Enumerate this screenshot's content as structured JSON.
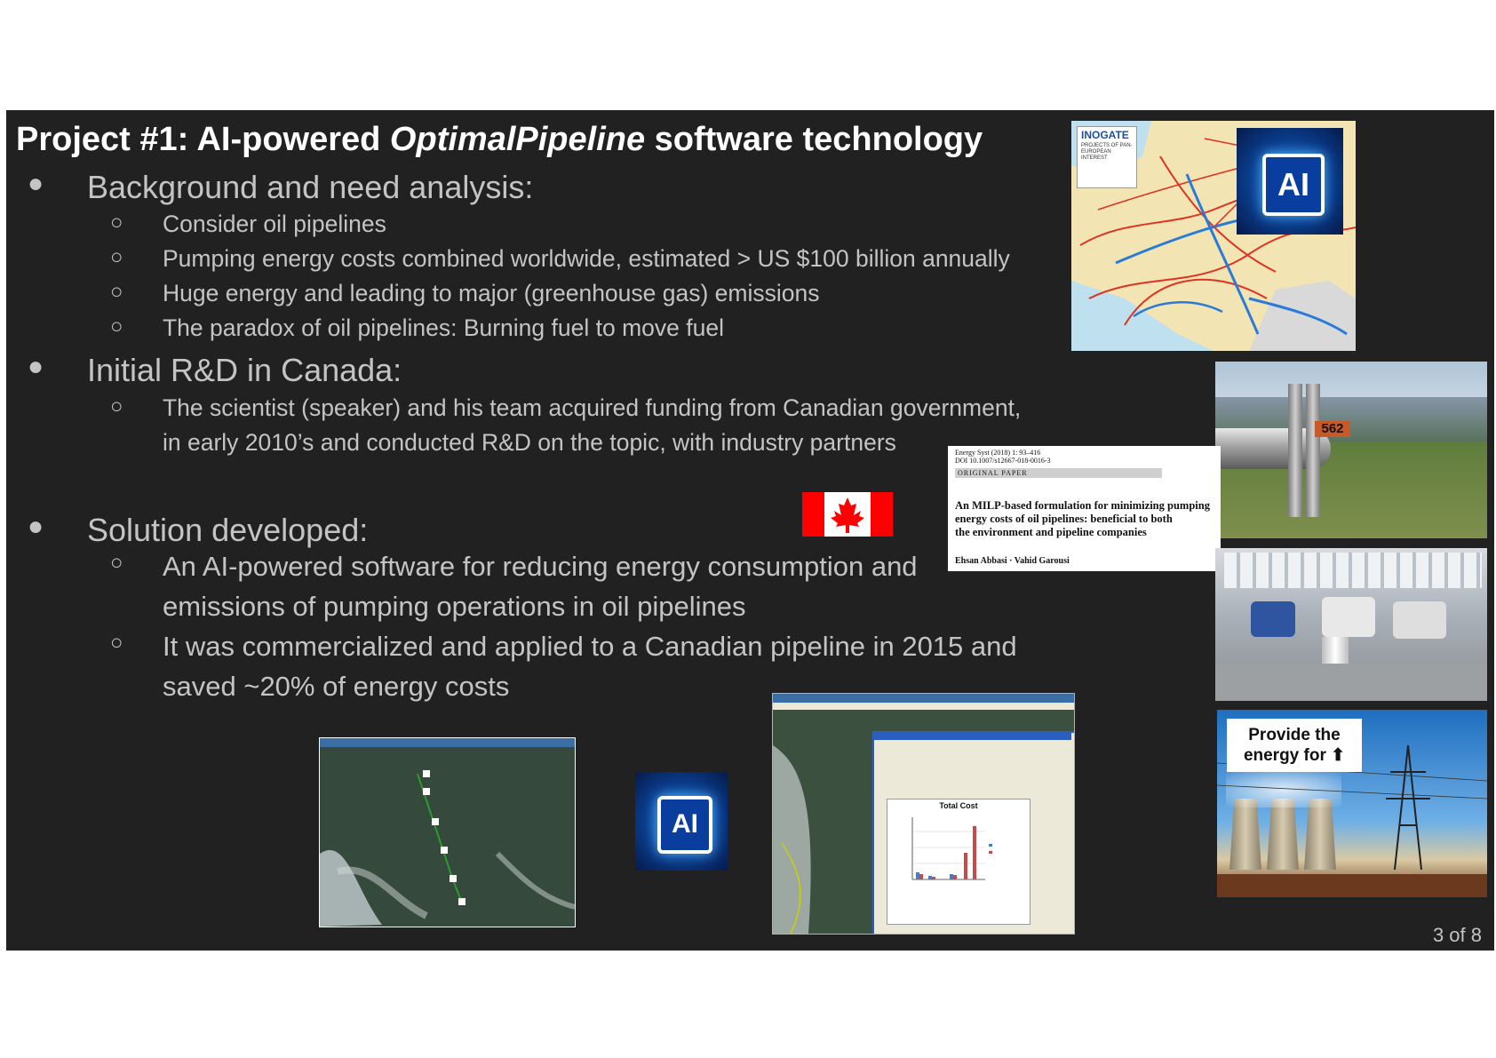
{
  "title": {
    "prefix": "Project #1: AI-powered ",
    "italic": "OptimalPipeline",
    "suffix": " software technology"
  },
  "sections": [
    {
      "heading": "Background and need analysis:",
      "items": [
        "Consider oil pipelines",
        "Pumping energy costs combined worldwide, estimated > US $100 billion annually",
        "Huge energy and leading to major (greenhouse gas) emissions",
        "The paradox of oil pipelines: Burning fuel to move fuel"
      ]
    },
    {
      "heading": "Initial R&D in Canada:",
      "items": [
        "The scientist (speaker) and his team acquired funding from Canadian government,",
        "in early 2010’s and conducted R&D on the topic, with industry partners"
      ]
    },
    {
      "heading": "Solution developed:",
      "items": [
        "An AI-powered software for reducing energy consumption and",
        "emissions of pumping operations in oil pipelines",
        "It was commercialized and applied to a Canadian pipeline in 2015 and",
        "saved ~20% of energy costs"
      ]
    }
  ],
  "bullet_symbol": "●",
  "sub_bullet_symbol": "○",
  "ai_badge": "AI",
  "map": {
    "logo": "INOGATE",
    "caption": "PROJECTS OF PAN-EUROPEAN INTEREST"
  },
  "pipeline_sign": "562",
  "paper": {
    "header1": "Energy Syst (2018) 1: 93–416",
    "header2": "DOI 10.1007/s12667-018-0016-3",
    "label": "ORIGINAL PAPER",
    "title_lines": [
      "An MILP-based formulation for minimizing pumping",
      "energy costs of oil pipelines: beneficial to both",
      "the environment and pipeline companies"
    ],
    "authors": "Ehsan Abbasi · Vahid Garousi"
  },
  "chart_window": {
    "title": "Total Cost"
  },
  "power_caption": "Provide the energy for ⬆",
  "page_number": "3 of 8",
  "colors": {
    "slide_bg": "#212121",
    "text": "#c4c4c4",
    "title": "#ffffff",
    "flag_red": "#ff0000"
  }
}
